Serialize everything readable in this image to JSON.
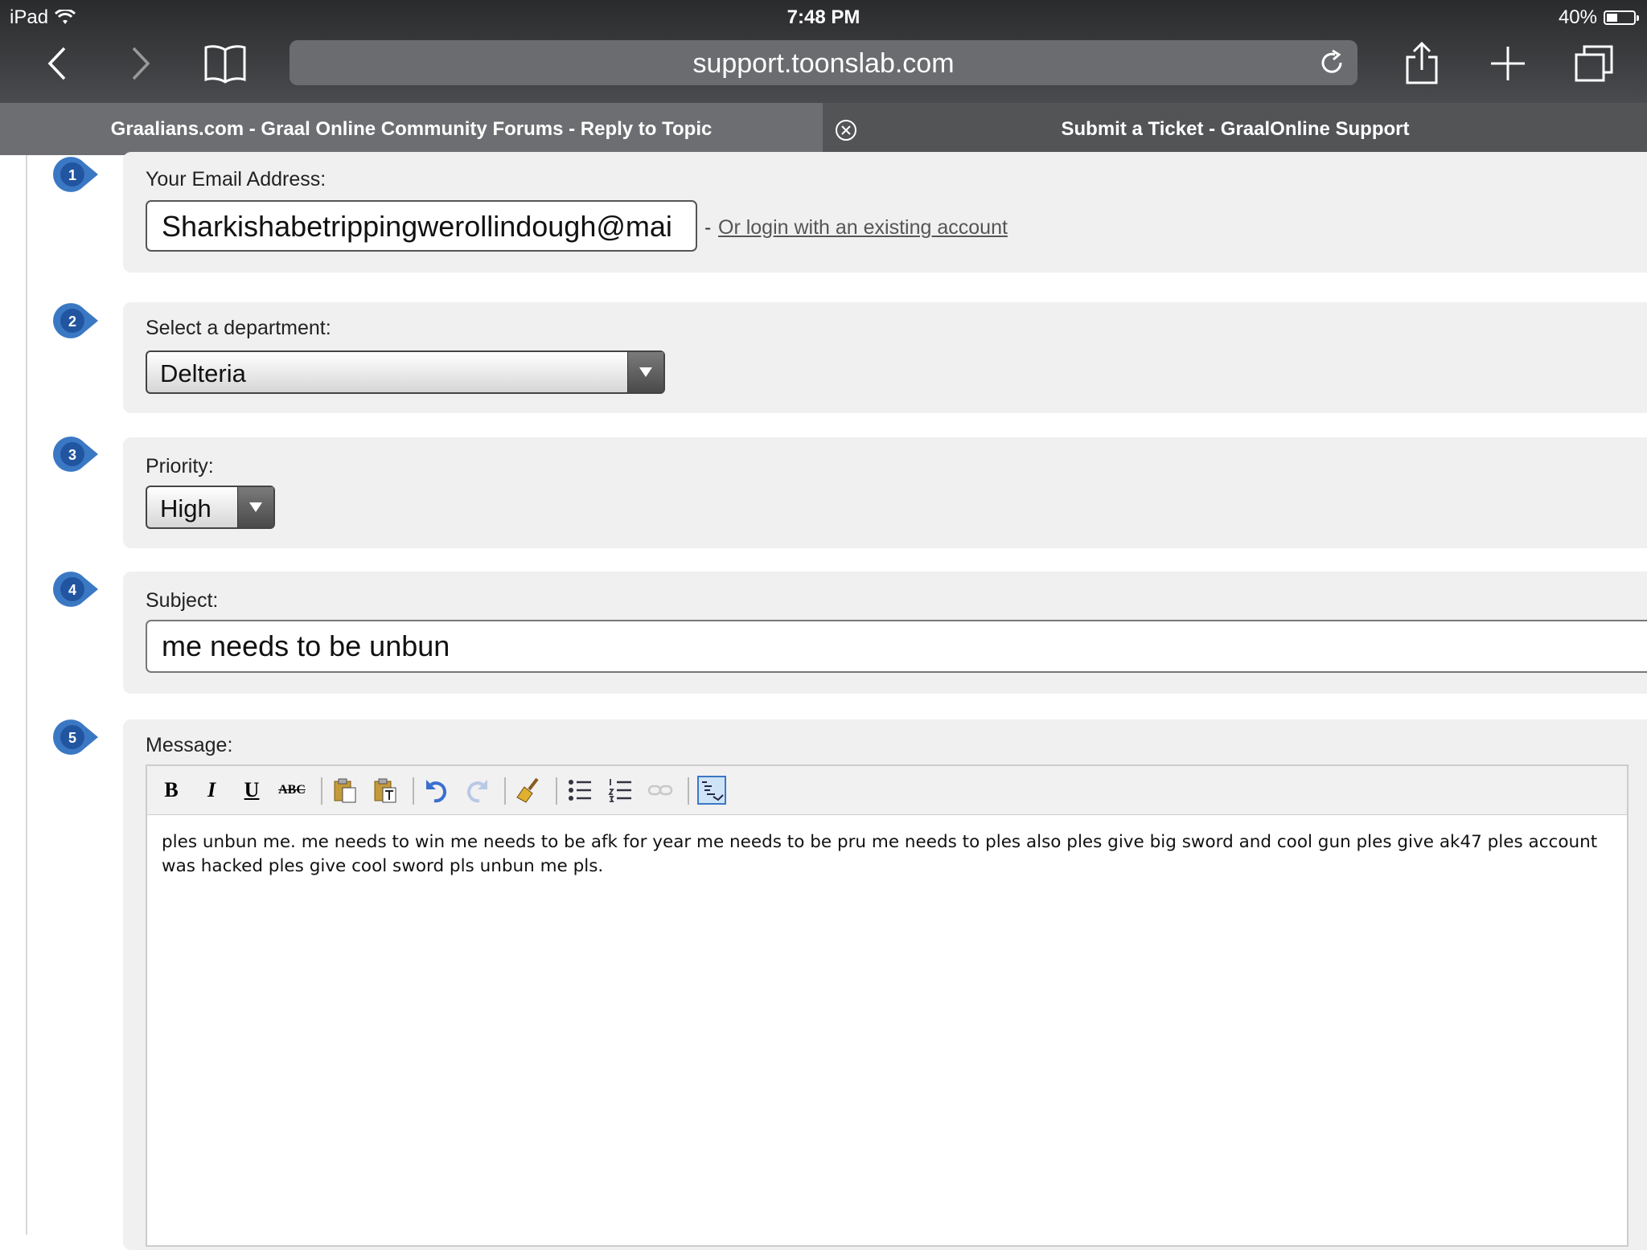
{
  "status_bar": {
    "device": "iPad",
    "time": "7:48 PM",
    "battery": "40%",
    "battery_level": 0.4
  },
  "browser": {
    "url": "support.toonslab.com",
    "tabs": [
      {
        "title": "Graalians.com - Graal Online Community Forums - Reply to Topic",
        "active": false
      },
      {
        "title": "Submit a Ticket - GraalOnline Support",
        "active": true
      }
    ],
    "icons": [
      "chevron-left-icon",
      "chevron-right-icon",
      "bookmarks-icon",
      "reload-icon",
      "share-icon",
      "plus-icon",
      "tabs-icon",
      "close-circle-icon"
    ]
  },
  "form": {
    "steps": [
      "1",
      "2",
      "3",
      "4",
      "5"
    ],
    "email": {
      "label": "Your Email Address:",
      "value": "Sharkishabetrippingwerollindough@mai",
      "separator": "-",
      "login_link": "Or login with an existing account"
    },
    "department": {
      "label": "Select a department:",
      "value": "Delteria"
    },
    "priority": {
      "label": "Priority:",
      "value": "High"
    },
    "subject": {
      "label": "Subject:",
      "value": "me needs to be unbun"
    },
    "message": {
      "label": "Message:",
      "toolbar": [
        "bold",
        "italic",
        "underline",
        "strikethrough",
        "paste",
        "paste-as-text",
        "undo",
        "redo",
        "clean",
        "bullet-list",
        "numbered-list",
        "link",
        "source"
      ],
      "toolbar_glyphs": {
        "bold": "B",
        "italic": "I",
        "underline": "U",
        "strike": "ABC"
      },
      "text": "ples unbun me. me needs to win me needs to be afk for year me needs to be pru me needs to ples also ples give big sword and cool gun ples give ak47 ples account was hacked ples give cool sword pls unbun me pls."
    }
  },
  "colors": {
    "step_badge": "#2e5fa8",
    "panel_bg": "#f0f0f0",
    "chrome_bg": "#3a3b3d"
  }
}
